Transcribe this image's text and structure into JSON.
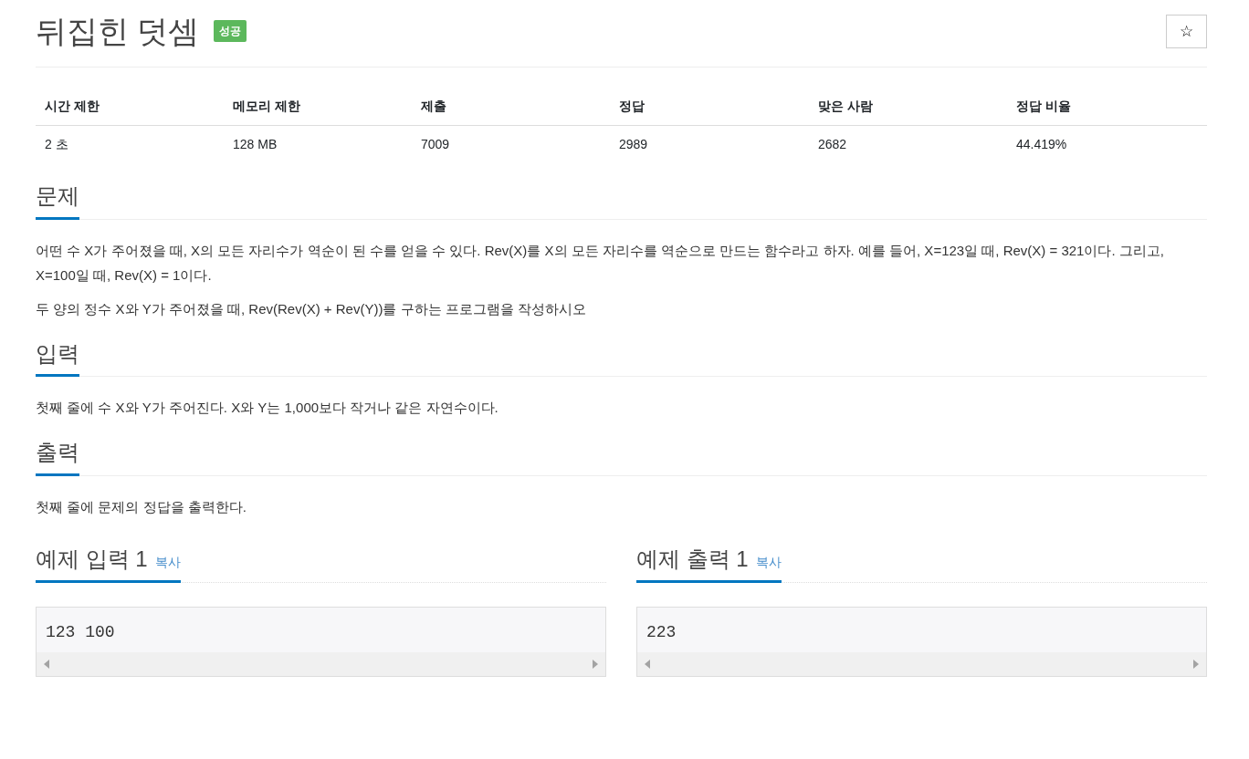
{
  "title": "뒤집힌 덧셈",
  "result_badge": "성공",
  "star_button": "☆",
  "info_table": {
    "columns": [
      "시간 제한",
      "메모리 제한",
      "제출",
      "정답",
      "맞은 사람",
      "정답 비율"
    ],
    "rows": [
      [
        "2 초",
        "128 MB",
        "7009",
        "2989",
        "2682",
        "44.419%"
      ]
    ]
  },
  "sections": [
    {
      "heading": "문제",
      "paragraphs": [
        "어떤 수 X가 주어졌을 때, X의 모든 자리수가 역순이 된 수를 얻을 수 있다. Rev(X)를 X의 모든 자리수를 역순으로 만드는 함수라고 하자. 예를 들어, X=123일 때, Rev(X) = 321이다. 그리고, X=100일 때, Rev(X) = 1이다.",
        "두 양의 정수 X와 Y가 주어졌을 때, Rev(Rev(X) + Rev(Y))를 구하는 프로그램을 작성하시오"
      ]
    },
    {
      "heading": "입력",
      "paragraphs": [
        "첫째 줄에 수 X와 Y가 주어진다. X와 Y는 1,000보다 작거나 같은 자연수이다."
      ]
    },
    {
      "heading": "출력",
      "paragraphs": [
        "첫째 줄에 문제의 정답을 출력한다."
      ]
    }
  ],
  "samples": [
    {
      "heading": "예제 입력 1",
      "copy_link": "복사",
      "content": "123 100"
    },
    {
      "heading": "예제 출력 1",
      "copy_link": "복사",
      "content": "223"
    }
  ]
}
